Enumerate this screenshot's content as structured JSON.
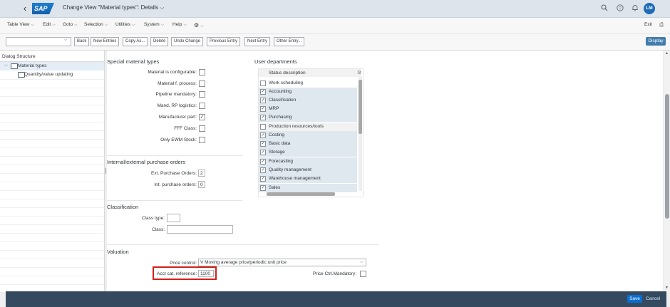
{
  "shell": {
    "logo": "SAP",
    "title": "Change View \"Material types\": Details",
    "title_chevron": "⌵",
    "avatar": "LM"
  },
  "menubar": {
    "items": [
      "Table View",
      "Edit",
      "Goto",
      "Selection",
      "Utilities",
      "System",
      "Help"
    ],
    "exit": "Exit"
  },
  "toolbar": {
    "buttons": [
      "Back",
      "New Entries",
      "Copy As...",
      "Delete",
      "Undo Change",
      "Previous Entry",
      "Next Entry",
      "Other Entry..."
    ],
    "display": "Display"
  },
  "tree": {
    "header": "Dialog Structure",
    "items": [
      "Material types",
      "Quantity/value updating"
    ]
  },
  "special": {
    "title": "Special material types",
    "fields": [
      {
        "label": "Material is configurable:",
        "checked": false
      },
      {
        "label": "Material f. process:",
        "checked": false
      },
      {
        "label": "Pipeline mandatory:",
        "checked": false
      },
      {
        "label": "Mand. RP logistics:",
        "checked": false
      },
      {
        "label": "Manufacturer part:",
        "checked": true
      },
      {
        "label": "FFF Class:",
        "checked": false
      },
      {
        "label": "Only EWM Stock:",
        "checked": false
      }
    ]
  },
  "purchase": {
    "title": "Internal/external purchase orders",
    "ext_label": "Ext. Purchase Orders:",
    "ext_value": "2",
    "int_label": "Int. purchase orders:",
    "int_value": "0"
  },
  "classification": {
    "title": "Classification",
    "class_type_label": "Class type:",
    "class_type_value": "",
    "class_label": "Class:",
    "class_value": ""
  },
  "valuation": {
    "title": "Valuation",
    "price_control_label": "Price control:",
    "price_control_value": "V Moving average price/periodic unit price",
    "acct_label": "Acct cat. reference:",
    "acct_value": "1100",
    "price_mand_label": "Price Ctrl.Mandatory:",
    "price_mand_checked": false
  },
  "user_departments": {
    "title": "User departments",
    "column": "Status description",
    "rows": [
      {
        "label": "Work scheduling",
        "checked": false
      },
      {
        "label": "Accounting",
        "checked": true
      },
      {
        "label": "Classification",
        "checked": true
      },
      {
        "label": "MRP",
        "checked": true
      },
      {
        "label": "Purchasing",
        "checked": true
      },
      {
        "label": "Production resources/tools",
        "checked": false
      },
      {
        "label": "Costing",
        "checked": true
      },
      {
        "label": "Basic data",
        "checked": true
      },
      {
        "label": "Storage",
        "checked": true
      },
      {
        "label": "Forecasting",
        "checked": true
      },
      {
        "label": "Quality management",
        "checked": true
      },
      {
        "label": "Warehouse management",
        "checked": true
      },
      {
        "label": "Sales",
        "checked": true
      }
    ]
  },
  "footer": {
    "save": "Save",
    "cancel": "Cancel"
  },
  "colors": {
    "shell": "#dde4ec",
    "footer": "#354a5f",
    "emphasis_button": "#0a6ed1",
    "display_button": "#427cac",
    "highlight_box": "#d1211b"
  }
}
